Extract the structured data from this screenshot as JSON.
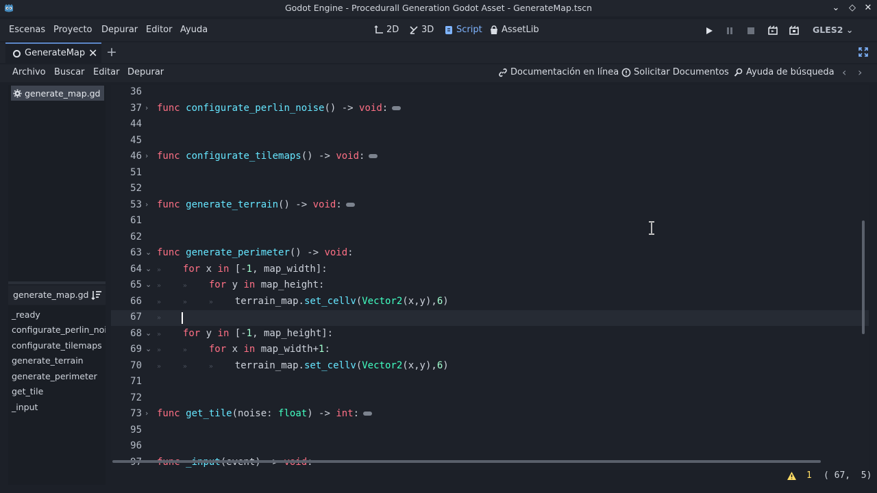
{
  "window": {
    "title": "Godot Engine - Procedurall Generation Godot Asset - GenerateMap.tscn"
  },
  "menu": {
    "items": [
      "Escenas",
      "Proyecto",
      "Depurar",
      "Editor",
      "Ayuda"
    ],
    "workspaces": [
      "2D",
      "3D",
      "Script",
      "AssetLib"
    ],
    "active_workspace": "Script",
    "renderer": "GLES2"
  },
  "scene_tabs": {
    "active": "GenerateMap"
  },
  "script_menu": {
    "items": [
      "Archivo",
      "Buscar",
      "Editar",
      "Depurar"
    ],
    "help": [
      "Documentación en línea",
      "Solicitar Documentos",
      "Ayuda de búsqueda"
    ]
  },
  "script_list": {
    "files": [
      "generate_map.gd"
    ]
  },
  "outline": {
    "file": "generate_map.gd",
    "methods": [
      "_ready",
      "configurate_perlin_noise",
      "configurate_tilemaps",
      "generate_terrain",
      "generate_perimeter",
      "get_tile",
      "_input"
    ]
  },
  "editor": {
    "current_line": 67,
    "lines": [
      {
        "n": "36",
        "fold": "",
        "text": ""
      },
      {
        "n": "37",
        "fold": "›",
        "text": "func configurate_perlin_noise() -> void:"
      },
      {
        "n": "44",
        "fold": "",
        "text": ""
      },
      {
        "n": "45",
        "fold": "",
        "text": ""
      },
      {
        "n": "46",
        "fold": "›",
        "text": "func configurate_tilemaps() -> void:"
      },
      {
        "n": "51",
        "fold": "",
        "text": ""
      },
      {
        "n": "52",
        "fold": "",
        "text": ""
      },
      {
        "n": "53",
        "fold": "›",
        "text": "func generate_terrain() -> void:"
      },
      {
        "n": "61",
        "fold": "",
        "text": ""
      },
      {
        "n": "62",
        "fold": "",
        "text": ""
      },
      {
        "n": "63",
        "fold": "⌄",
        "text": "func generate_perimeter() -> void:"
      },
      {
        "n": "64",
        "fold": "⌄",
        "text": "for x in [-1, map_width]:"
      },
      {
        "n": "65",
        "fold": "⌄",
        "text": "for y in map_height:"
      },
      {
        "n": "66",
        "fold": "",
        "text": "terrain_map.set_cellv(Vector2(x,y),6)"
      },
      {
        "n": "67",
        "fold": "",
        "text": ""
      },
      {
        "n": "68",
        "fold": "⌄",
        "text": "for y in [-1, map_height]:"
      },
      {
        "n": "69",
        "fold": "⌄",
        "text": "for x in map_width+1:"
      },
      {
        "n": "70",
        "fold": "",
        "text": "terrain_map.set_cellv(Vector2(x,y),6)"
      },
      {
        "n": "71",
        "fold": "",
        "text": ""
      },
      {
        "n": "72",
        "fold": "",
        "text": ""
      },
      {
        "n": "73",
        "fold": "›",
        "text": "func get_tile(noise: float) -> int:"
      },
      {
        "n": "95",
        "fold": "",
        "text": ""
      },
      {
        "n": "96",
        "fold": "",
        "text": ""
      },
      {
        "n": "97",
        "fold": "",
        "text": "func _input(event) -> void:"
      }
    ]
  },
  "status": {
    "warnings": "1",
    "cursor": "( 67,  5)"
  },
  "colors": {
    "keyword": "#ff7085",
    "function": "#66e6ff",
    "type": "#42ffc2",
    "number": "#a3ffd0",
    "accent": "#7fb4ff",
    "warning": "#ffdd65"
  }
}
